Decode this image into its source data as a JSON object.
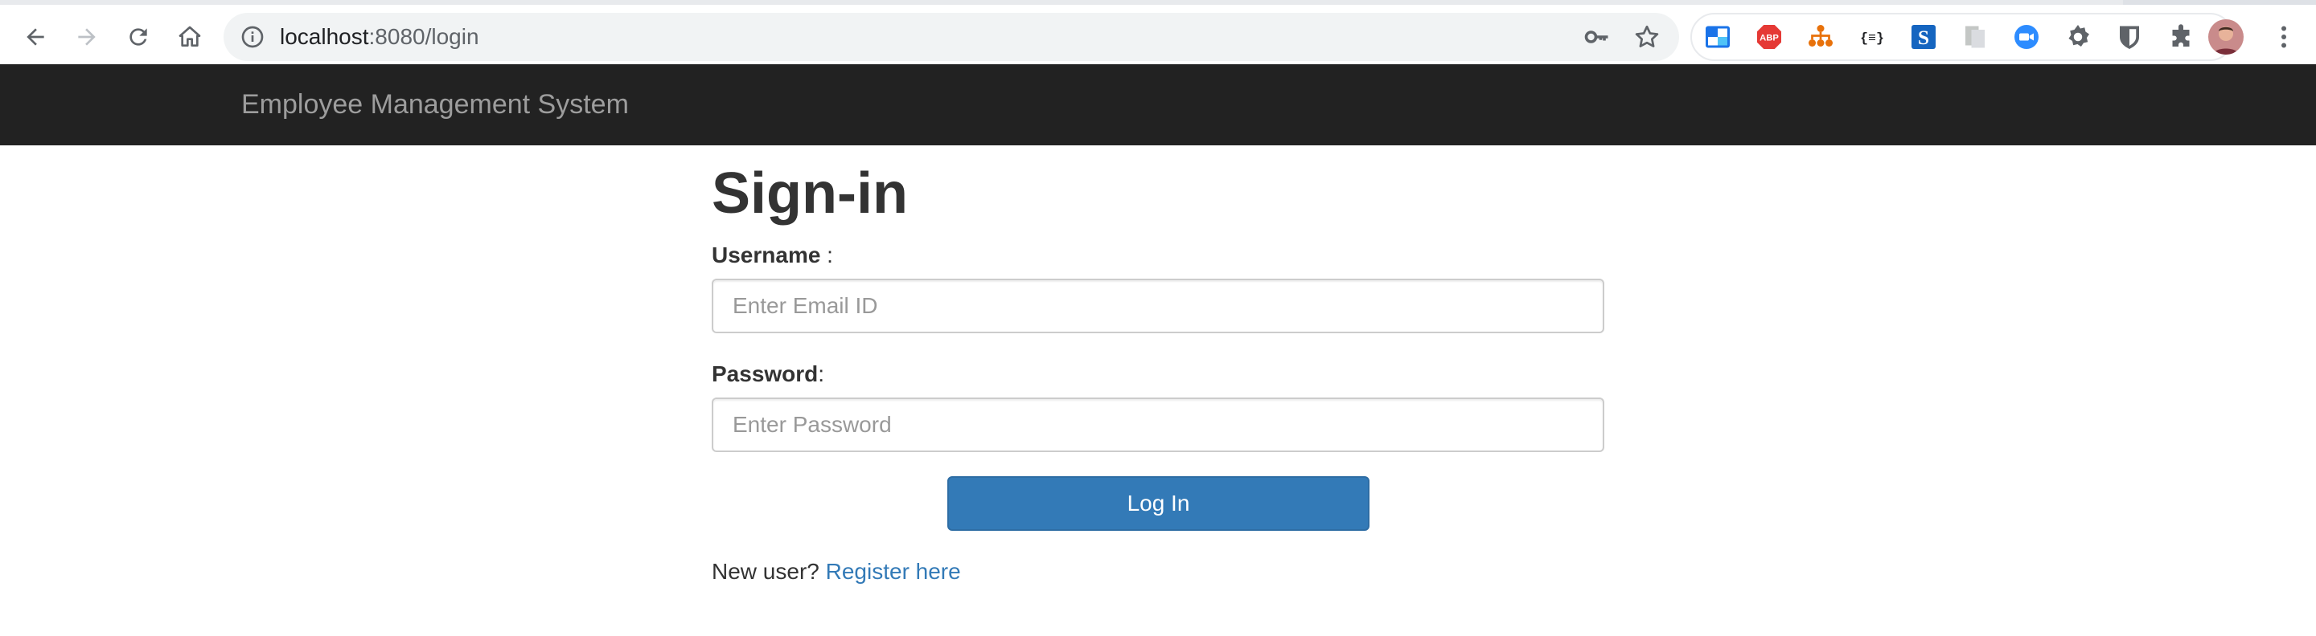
{
  "browser": {
    "url_host": "localhost",
    "url_rest": ":8080/login",
    "extensions": [
      {
        "name": "window-icon"
      },
      {
        "name": "adblock-icon",
        "label": "ABP"
      },
      {
        "name": "sitemap-icon"
      },
      {
        "name": "json-icon",
        "label": "{≡}"
      },
      {
        "name": "s-logo-icon",
        "label": "S"
      },
      {
        "name": "pdf-icon"
      },
      {
        "name": "zoom-icon"
      },
      {
        "name": "gear-icon"
      },
      {
        "name": "bitwarden-icon"
      },
      {
        "name": "puzzle-icon"
      }
    ]
  },
  "navbar": {
    "brand": "Employee Management System"
  },
  "form": {
    "title": "Sign-in",
    "username_label": "Username",
    "username_suffix": " :",
    "username_placeholder": "Enter Email ID",
    "password_label": "Password",
    "password_suffix": ":",
    "password_placeholder": "Enter Password",
    "submit_label": "Log In",
    "register_prompt": "New user? ",
    "register_link": "Register here"
  },
  "colors": {
    "navbar_bg": "#222222",
    "brand_text": "#9d9d9d",
    "primary": "#337ab7",
    "text": "#333333"
  }
}
